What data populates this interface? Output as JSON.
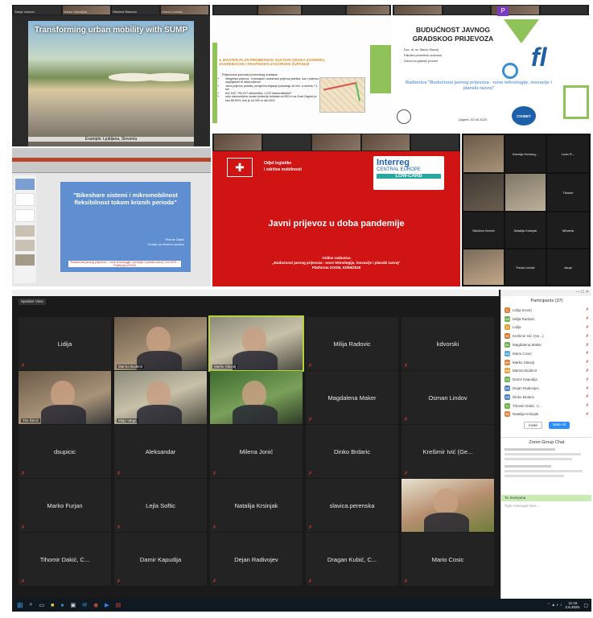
{
  "panel_sump": {
    "title": "Transforming urban mobility with SUMP",
    "caption": "Example: Ljubljana, Slovenia",
    "thumbs": [
      "Sanja Vukovic",
      "Marko Slavuljica",
      "Nikolina Blazevic",
      "Gianni Camiso"
    ]
  },
  "panel_plan": {
    "heading": "4. MASTER PLAN PROMETNOG SUSTAVA GRADA ZAGREBA, ZAGREBAČKE I KRAPINSKO-ZAGORSKE ŽUPANIJE",
    "subheading": "Prijevozna ponuda prometnog sustava:",
    "bullets": [
      "Integrirani prijevoz - tramvajski i autobusni prijevoz putnika, kao i prijevoz uspinjačom te taksi prijevoz",
      "Javni prijevoz putnika, prosječno trajanje putovanja 16 min, a dužina 7,1 km",
      "641 km², 790.017 stanovnika, 1.232 stanovnika/km²",
      "udio stanovništva unutar područja dohvata od 500 m za Grad Zagreb je oko 88-99%, dok je od 300 m oko 82%"
    ]
  },
  "panel_budu": {
    "title_line1": "BUDUĆNOST JAVNOG",
    "title_line2": "GRADSKOG PRIJEVOZA",
    "author": "Doc. dr. sc. Marko Slavulj",
    "faculty": "Fakultet prometnih znanosti",
    "dept": "Zavod za gradski promet",
    "workshop": "Radionica \"Budućnost javnog prijevoza - nove tehnologije, inovacije i planski razvoj\"",
    "date": "Zagreb, 02.06.2020.",
    "badge": "P",
    "logo": "CIVINET"
  },
  "panel_bike": {
    "title": "\"Bikeshare sistemi i mikromobilnost fleksibilnost tokom kriznih perioda\"",
    "author": "Tihomir Dakić",
    "org": "Centar za životnu sredinu",
    "footer": "\"Budućnost javnog prijevoza – nove tehnologije, inovacije i planski razvoj\" 2.6.2020. – Platforma ZOOM"
  },
  "panel_pandemic": {
    "dept_line1": "Odjel logistike",
    "dept_line2": "i održive mobilnosti",
    "interreg": "Interreg",
    "ce": "CENTRAL EUROPE",
    "lowcarb": "LOW-CARB",
    "title": "Javni prijevoz u doba pandemije",
    "footer_line1": "Online radionica",
    "footer_line2": "„Budućnost javnog prijevoza - nove tehnologije, inovacije i planski razvoj\"",
    "footer_line3": "Platforma ZOOM, 02/06/2020"
  },
  "panel_gallery": {
    "cells": [
      "",
      "Ksenija Horberg...",
      "Lean R...",
      "",
      "",
      "Tihomir",
      "Nikolina Hornet",
      "Natalija Krsinjak",
      "Mihaela",
      "",
      "Paula Linčak",
      "dsupi",
      "Dragana Skende...",
      "Vesa Smilovic",
      "Emanuel R..."
    ]
  },
  "zoom_main": {
    "title": "Zoom Meeting",
    "speaker_view": "Speaker View",
    "tiles": [
      {
        "name": "Lidija",
        "kind": "name"
      },
      {
        "name": "",
        "kind": "video",
        "label": "Marina Budimir"
      },
      {
        "name": "",
        "kind": "video2",
        "label": "Marko Slavulj"
      },
      {
        "name": "Milija Radovic",
        "kind": "name"
      },
      {
        "name": "kdvorski",
        "kind": "name"
      },
      {
        "name": "",
        "kind": "video",
        "label": "Tim Štrcić"
      },
      {
        "name": "",
        "kind": "video2",
        "label": "Maja Varga"
      },
      {
        "name": "",
        "kind": "video3",
        "label": ""
      },
      {
        "name": "Magdalena Maker",
        "kind": "name"
      },
      {
        "name": "Osman Lindov",
        "kind": "name"
      },
      {
        "name": "dsupicic",
        "kind": "name"
      },
      {
        "name": "Aleksandar",
        "kind": "name"
      },
      {
        "name": "Milena Jonić",
        "kind": "name"
      },
      {
        "name": "Dinko Brdaric",
        "kind": "name"
      },
      {
        "name": "Krešimir Ivić (Ge...",
        "kind": "name"
      },
      {
        "name": "Marko Furjan",
        "kind": "name"
      },
      {
        "name": "Lejla Softic",
        "kind": "name"
      },
      {
        "name": "Natalija Krsinjak",
        "kind": "name"
      },
      {
        "name": "slavica.perenska",
        "kind": "name"
      },
      {
        "name": "",
        "kind": "video4",
        "label": ""
      },
      {
        "name": "Tihomir Dakić, C...",
        "kind": "name"
      },
      {
        "name": "Damir Kapudija",
        "kind": "name"
      },
      {
        "name": "Dejan Radivojev",
        "kind": "name"
      },
      {
        "name": "Dragan Kubić, C...",
        "kind": "name"
      },
      {
        "name": "Mario Cosic",
        "kind": "name"
      }
    ]
  },
  "participants": {
    "header": "Participants (37)",
    "items": [
      {
        "initials": "LI",
        "name": "Lidija (Host)",
        "color": "#e0823a"
      },
      {
        "initials": "MR",
        "name": "Milija Radovic",
        "color": "#6bb04a"
      },
      {
        "initials": "Li",
        "name": "Lidija",
        "color": "#e0a63a"
      },
      {
        "initials": "KE",
        "name": "Krešimir Ivić (Ge...)",
        "color": "#d77b2c"
      },
      {
        "initials": "ML",
        "name": "Magdalena Maker",
        "color": "#6bb04a"
      },
      {
        "initials": "MA",
        "name": "Mario Cosic",
        "color": "#53a6d6"
      },
      {
        "initials": "MS",
        "name": "Marko Slavulj",
        "color": "#e0823a"
      },
      {
        "initials": "MB",
        "name": "Marina Budimir",
        "color": "#e0a63a"
      },
      {
        "initials": "DK",
        "name": "Damir Kapudija",
        "color": "#6bb04a"
      },
      {
        "initials": "DR",
        "name": "Dejan Radivojev",
        "color": "#4a7fc0"
      },
      {
        "initials": "DB",
        "name": "Dinko Brdaric",
        "color": "#4a7fc0"
      },
      {
        "initials": "TD",
        "name": "Tihomir Dakić, C...",
        "color": "#6bb04a"
      },
      {
        "initials": "NK",
        "name": "Natalija Krsinjak",
        "color": "#e0823a"
      }
    ],
    "invite": "Invite",
    "mute_all": "Mute All",
    "chat_header": "Zoom Group Chat",
    "chat_to": "To: Everyone",
    "chat_placeholder": "Type message here..."
  },
  "taskbar": {
    "clock": "11:15",
    "date": "2.6.2020."
  }
}
